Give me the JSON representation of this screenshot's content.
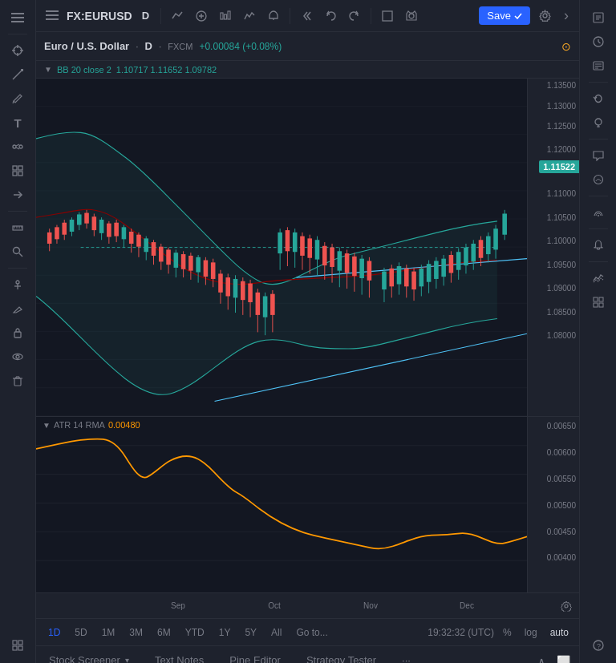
{
  "header": {
    "symbol": "FX:EURUSD",
    "timeframe": "D",
    "title": "Euro / U.S. Dollar",
    "separator": "·",
    "timeframe_full": "D",
    "exchange": "FXCM",
    "price_change": "+0.00084 (+0.08%)",
    "current_price": "1.11522",
    "bb_label": "BB 20 close 2",
    "bb_values": "1.10717  1.11652  1.09782",
    "save_label": "Save"
  },
  "price_levels": [
    {
      "price": "1.13500",
      "pct": 2
    },
    {
      "price": "1.13000",
      "pct": 8
    },
    {
      "price": "1.12500",
      "pct": 14
    },
    {
      "price": "1.12000",
      "pct": 21
    },
    {
      "price": "1.11500",
      "pct": 27
    },
    {
      "price": "1.11000",
      "pct": 34
    },
    {
      "price": "1.10500",
      "pct": 41
    },
    {
      "price": "1.10000",
      "pct": 48
    },
    {
      "price": "1.09500",
      "pct": 55
    },
    {
      "price": "1.09000",
      "pct": 62
    },
    {
      "price": "1.08500",
      "pct": 69
    },
    {
      "price": "1.08000",
      "pct": 76
    }
  ],
  "indicator": {
    "name": "ATR",
    "period": "14",
    "type": "RMA",
    "value": "0.00480",
    "levels": [
      {
        "price": "0.00650",
        "pct": 5
      },
      {
        "price": "0.00600",
        "pct": 20
      },
      {
        "price": "0.00550",
        "pct": 35
      },
      {
        "price": "0.00500",
        "pct": 50
      },
      {
        "price": "0.00450",
        "pct": 65
      },
      {
        "price": "0.00400",
        "pct": 80
      }
    ]
  },
  "time_labels": [
    {
      "label": "Sep",
      "pct": 22
    },
    {
      "label": "Oct",
      "pct": 42
    },
    {
      "label": "Nov",
      "pct": 62
    },
    {
      "label": "Dec",
      "pct": 82
    }
  ],
  "timeframes": [
    {
      "label": "1D",
      "active": true
    },
    {
      "label": "5D",
      "active": false
    },
    {
      "label": "1M",
      "active": false
    },
    {
      "label": "3M",
      "active": false
    },
    {
      "label": "6M",
      "active": false
    },
    {
      "label": "YTD",
      "active": false
    },
    {
      "label": "1Y",
      "active": false
    },
    {
      "label": "5Y",
      "active": false
    },
    {
      "label": "All",
      "active": false
    }
  ],
  "goto_label": "Go to...",
  "time_display": "19:32:32 (UTC)",
  "scale_options": [
    {
      "label": "%",
      "active": false
    },
    {
      "label": "log",
      "active": false
    },
    {
      "label": "auto",
      "active": true
    }
  ],
  "bottom_tabs": [
    {
      "label": "Stock Screener",
      "has_chevron": true,
      "active": false
    },
    {
      "label": "Text Notes",
      "has_chevron": false,
      "active": false
    },
    {
      "label": "Pine Editor",
      "has_chevron": false,
      "active": false
    },
    {
      "label": "Strategy Tester",
      "has_chevron": false,
      "active": false
    },
    {
      "label": "···",
      "has_chevron": false,
      "active": false
    }
  ],
  "left_toolbar_icons": [
    "☰",
    "⊕",
    "📈",
    "↗",
    "📊",
    "🔔",
    "🖊",
    "✏",
    "T",
    "🤝",
    "⊞",
    "←",
    "📏",
    "🔍",
    "📌",
    "📋",
    "🔒",
    "👁",
    "🗑"
  ],
  "right_toolbar_icons": [
    "≡",
    "🕐",
    "≡",
    "↺",
    "💡",
    "💬",
    "💬",
    "📡",
    "🔔",
    "〰",
    "⊞",
    "?"
  ]
}
